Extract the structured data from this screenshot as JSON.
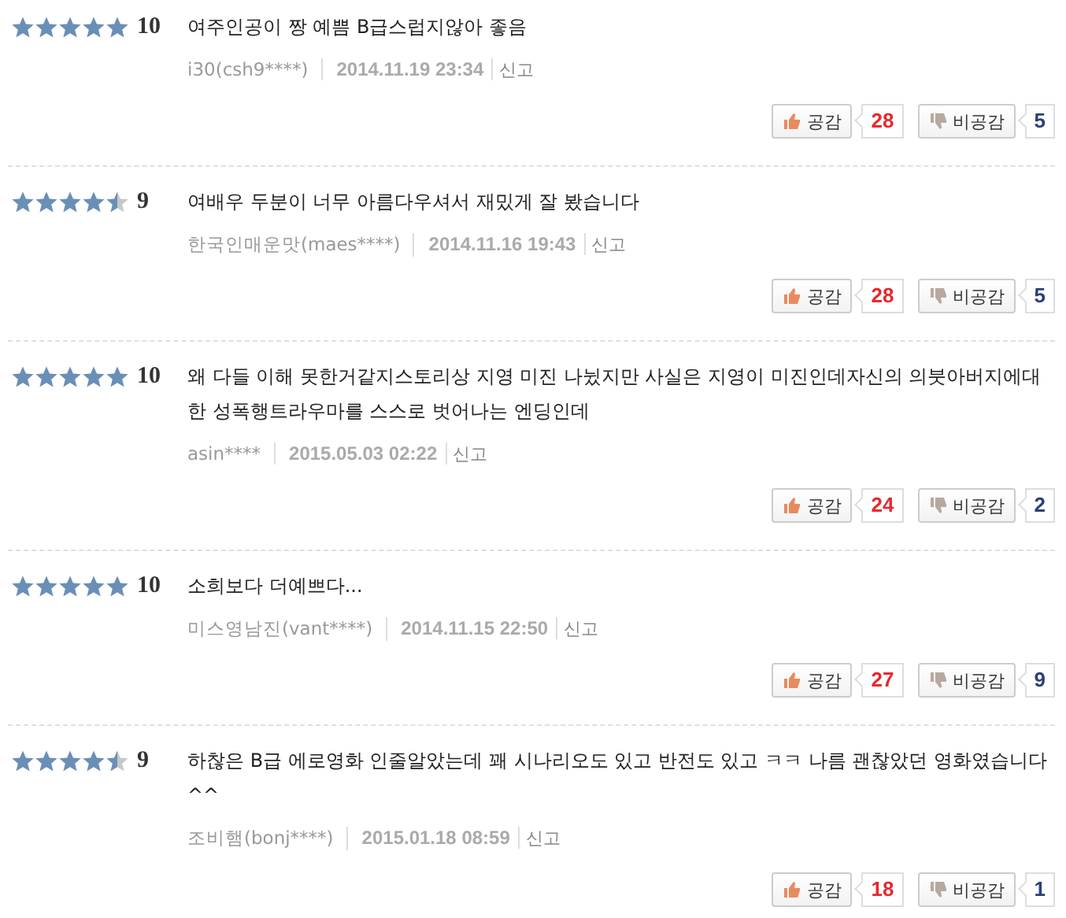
{
  "reviews": [
    {
      "stars": 5,
      "score": "10",
      "text": "여주인공이 짱 예쁨 B급스럽지않아 좋음",
      "author": "i30(csh9****)",
      "date": "2014.11.19 23:34",
      "report": "신고",
      "like_label": "공감",
      "like_count": "28",
      "dislike_label": "비공감",
      "dislike_count": "5"
    },
    {
      "stars": 4.5,
      "score": "9",
      "text": "여배우 두분이 너무 아름다우셔서 재밌게 잘 봤습니다",
      "author": "한국인매운맛(maes****)",
      "date": "2014.11.16 19:43",
      "report": "신고",
      "like_label": "공감",
      "like_count": "28",
      "dislike_label": "비공감",
      "dislike_count": "5"
    },
    {
      "stars": 5,
      "score": "10",
      "text": "왜 다들 이해 못한거같지스토리상 지영 미진 나뉬지만 사실은 지영이 미진인데자신의 의붓아버지에대한 성폭행트라우마를 스스로 벗어나는 엔딩인데",
      "author": "asin****",
      "date": "2015.05.03 02:22",
      "report": "신고",
      "like_label": "공감",
      "like_count": "24",
      "dislike_label": "비공감",
      "dislike_count": "2"
    },
    {
      "stars": 5,
      "score": "10",
      "text": "소희보다 더예쁘다...",
      "author": "미스영남진(vant****)",
      "date": "2014.11.15 22:50",
      "report": "신고",
      "like_label": "공감",
      "like_count": "27",
      "dislike_label": "비공감",
      "dislike_count": "9"
    },
    {
      "stars": 4.5,
      "score": "9",
      "text": "하찮은 B급 에로영화 인줄알았는데 꽤 시나리오도 있고 반전도 있고 ㅋㅋ 나름 괜찮았던 영화였습니다^^",
      "author": "조비햄(bonj****)",
      "date": "2015.01.18 08:59",
      "report": "신고",
      "like_label": "공감",
      "like_count": "18",
      "dislike_label": "비공감",
      "dislike_count": "1"
    }
  ]
}
